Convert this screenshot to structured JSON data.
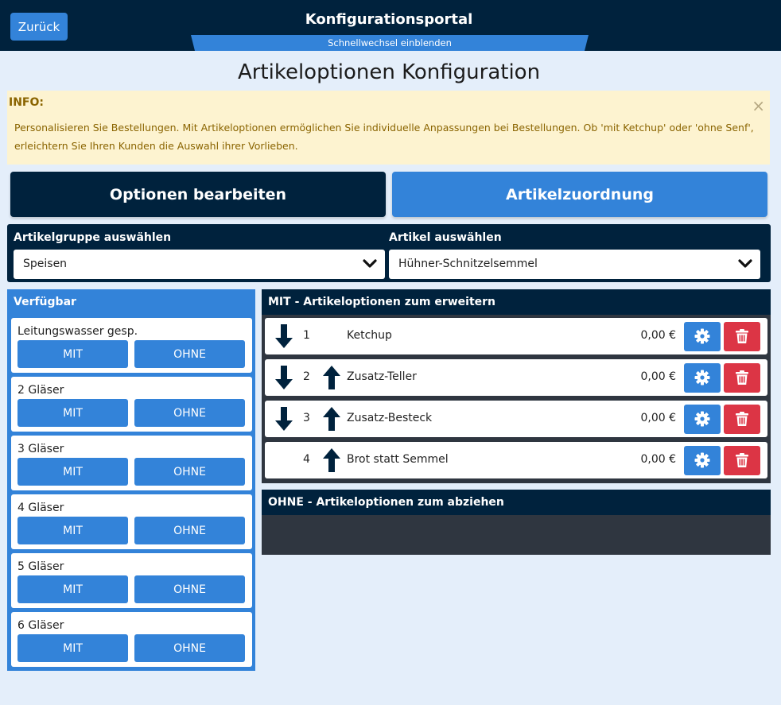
{
  "header": {
    "back_label": "Zurück",
    "title": "Konfigurationsportal",
    "quick_switch": "Schnellwechsel einblenden"
  },
  "page_title": "Artikeloptionen Konfiguration",
  "info": {
    "label": "INFO:",
    "close": "×",
    "text": "Personalisieren Sie Bestellungen. Mit Artikeloptionen ermöglichen Sie individuelle Anpassungen bei Bestellungen. Ob 'mit Ketchup' oder 'ohne Senf', erleichtern Sie Ihren Kunden die Auswahl ihrer Vorlieben."
  },
  "tabs": {
    "edit": "Optionen bearbeiten",
    "assign": "Artikelzuordnung"
  },
  "filters": {
    "group_label": "Artikelgruppe auswählen",
    "group_value": "Speisen",
    "article_label": "Artikel auswählen",
    "article_value": "Hühner-Schnitzelsemmel"
  },
  "available": {
    "title": "Verfügbar",
    "mit_label": "MIT",
    "ohne_label": "OHNE",
    "items": [
      "Leitungswasser gesp.",
      "2 Gläser",
      "3 Gläser",
      "4 Gläser",
      "5 Gläser",
      "6 Gläser"
    ]
  },
  "mit_panel": {
    "title": "MIT - Artikeloptionen zum erweitern",
    "rows": [
      {
        "num": "1",
        "name": "Ketchup",
        "price": "0,00 €"
      },
      {
        "num": "2",
        "name": "Zusatz-Teller",
        "price": "0,00 €"
      },
      {
        "num": "3",
        "name": "Zusatz-Besteck",
        "price": "0,00 €"
      },
      {
        "num": "4",
        "name": "Brot statt Semmel",
        "price": "0,00 €"
      }
    ]
  },
  "ohne_panel": {
    "title": "OHNE - Artikeloptionen zum abziehen"
  },
  "colors": {
    "navy": "#00223d",
    "blue": "#3383d9",
    "red": "#dc3545",
    "page_bg": "#e4eefa",
    "info_bg": "#fdf3d0",
    "panel_dark": "#2f3640"
  }
}
